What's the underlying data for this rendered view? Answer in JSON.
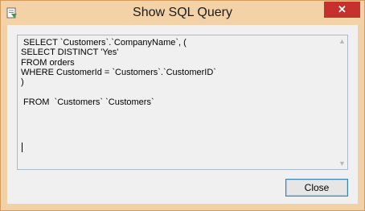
{
  "window": {
    "title": "Show SQL Query",
    "close_glyph": "✕"
  },
  "query": {
    "text": " SELECT `Customers`.`CompanyName`, (\nSELECT DISTINCT 'Yes'\nFROM orders\nWHERE CustomerId = `Customers`.`CustomerID`\n)\n\n FROM  `Customers` `Customers`"
  },
  "scrollbar": {
    "up_glyph": "▲",
    "down_glyph": "▼"
  },
  "buttons": {
    "close_label": "Close"
  },
  "icons": {
    "app": "sql-query-icon",
    "close": "close-icon"
  },
  "colors": {
    "title_bar": "#f3d2a8",
    "window_border": "#d39a5a",
    "close_button_red": "#c7312d",
    "dialog_face": "#f0f0f0",
    "focus_border": "#3c7fb1"
  }
}
